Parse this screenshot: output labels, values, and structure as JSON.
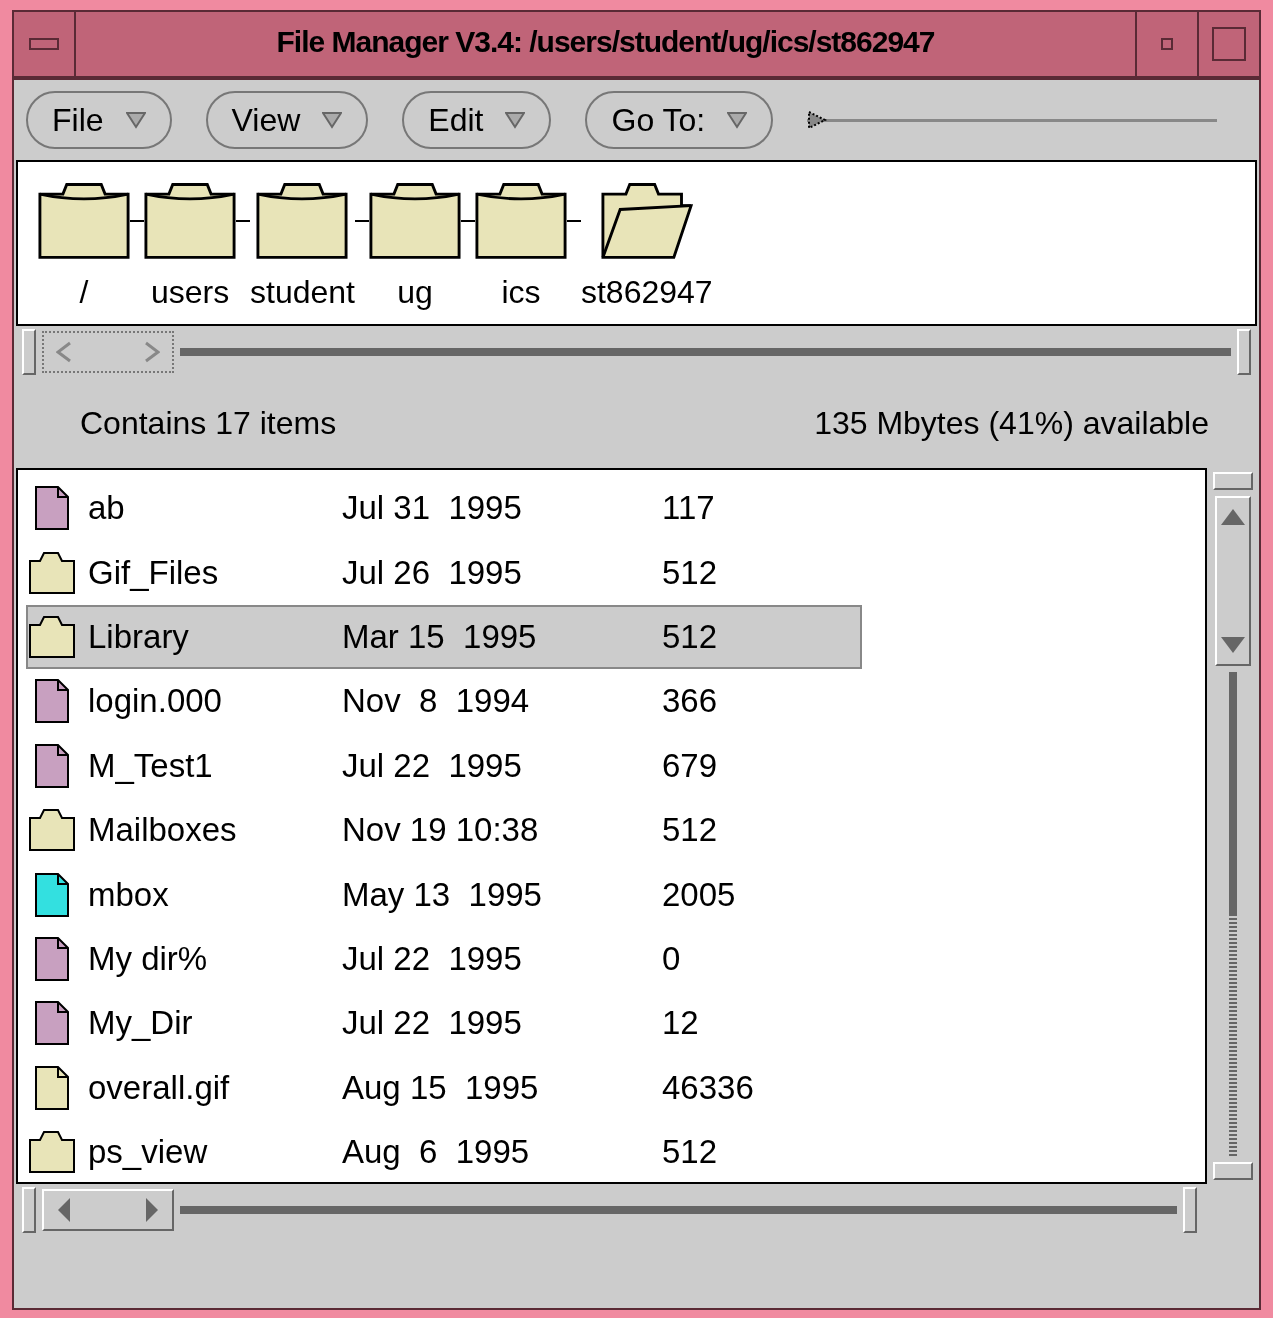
{
  "window": {
    "title": "File Manager V3.4: /users/student/ug/ics/st862947"
  },
  "menus": [
    {
      "label": "File"
    },
    {
      "label": "View"
    },
    {
      "label": "Edit"
    },
    {
      "label": "Go To:"
    }
  ],
  "goto_slider": {
    "level": 0
  },
  "path": [
    {
      "label": "/",
      "kind": "folder"
    },
    {
      "label": "users",
      "kind": "folder"
    },
    {
      "label": "student",
      "kind": "folder"
    },
    {
      "label": "ug",
      "kind": "folder"
    },
    {
      "label": "ics",
      "kind": "folder"
    },
    {
      "label": "st862947",
      "kind": "open"
    }
  ],
  "status": {
    "count": "Contains 17 items",
    "space": "135 Mbytes (41%) available"
  },
  "files": [
    {
      "name": "ab",
      "date": "Jul 31  1995",
      "size": "117",
      "kind": "file",
      "color": "#c8a0c0",
      "selected": false
    },
    {
      "name": "Gif_Files",
      "date": "Jul 26  1995",
      "size": "512",
      "kind": "folder",
      "selected": false
    },
    {
      "name": "Library",
      "date": "Mar 15  1995",
      "size": "512",
      "kind": "folder",
      "selected": true
    },
    {
      "name": "login.000",
      "date": "Nov  8  1994",
      "size": "366",
      "kind": "file",
      "color": "#c8a0c0",
      "selected": false
    },
    {
      "name": "M_Test1",
      "date": "Jul 22  1995",
      "size": "679",
      "kind": "file",
      "color": "#c8a0c0",
      "selected": false
    },
    {
      "name": "Mailboxes",
      "date": "Nov 19 10:38",
      "size": "512",
      "kind": "folder",
      "selected": false
    },
    {
      "name": "mbox",
      "date": "May 13  1995",
      "size": "2005",
      "kind": "file",
      "color": "#33e0e0",
      "selected": false
    },
    {
      "name": "My dir%",
      "date": "Jul 22  1995",
      "size": "0",
      "kind": "file",
      "color": "#c8a0c0",
      "selected": false
    },
    {
      "name": "My_Dir",
      "date": "Jul 22  1995",
      "size": "12",
      "kind": "file",
      "color": "#c8a0c0",
      "selected": false
    },
    {
      "name": "overall.gif",
      "date": "Aug 15  1995",
      "size": "46336",
      "kind": "file",
      "color": "#e8e4b8",
      "selected": false
    },
    {
      "name": "ps_view",
      "date": "Aug  6  1995",
      "size": "512",
      "kind": "folder",
      "selected": false
    }
  ]
}
